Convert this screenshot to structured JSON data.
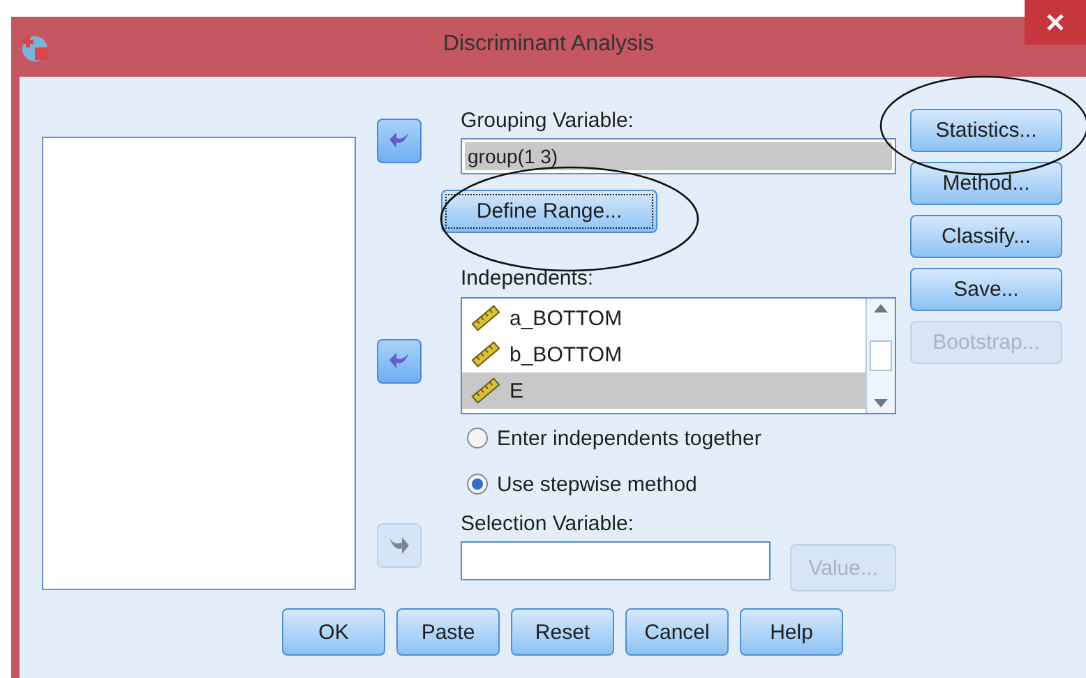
{
  "window": {
    "title": "Discriminant Analysis"
  },
  "move_buttons": [
    {
      "kind": "left",
      "disabled": false
    },
    {
      "kind": "left",
      "disabled": false
    },
    {
      "kind": "right",
      "disabled": true
    }
  ],
  "grouping_variable": {
    "label": "Grouping Variable:",
    "value": "group(1 3)"
  },
  "define_range_button": {
    "label": "Define Range...",
    "focused": true
  },
  "independents": {
    "label": "Independents:",
    "items": [
      {
        "name": "a_BOTTOM",
        "selected": false
      },
      {
        "name": "b_BOTTOM",
        "selected": false
      },
      {
        "name": "E",
        "selected": true
      }
    ]
  },
  "method": [
    {
      "label": "Enter independents together",
      "selected": false
    },
    {
      "label": "Use stepwise method",
      "selected": true
    }
  ],
  "selection_variable": {
    "label": "Selection Variable:",
    "value_button": {
      "label": "Value...",
      "disabled": true
    }
  },
  "side_buttons": [
    {
      "label": "Statistics...",
      "disabled": false
    },
    {
      "label": "Method...",
      "disabled": false
    },
    {
      "label": "Classify...",
      "disabled": false
    },
    {
      "label": "Save...",
      "disabled": false
    },
    {
      "label": "Bootstrap...",
      "disabled": true
    }
  ],
  "bottom_buttons": [
    {
      "label": "OK"
    },
    {
      "label": "Paste"
    },
    {
      "label": "Reset"
    },
    {
      "label": "Cancel"
    },
    {
      "label": "Help"
    }
  ]
}
